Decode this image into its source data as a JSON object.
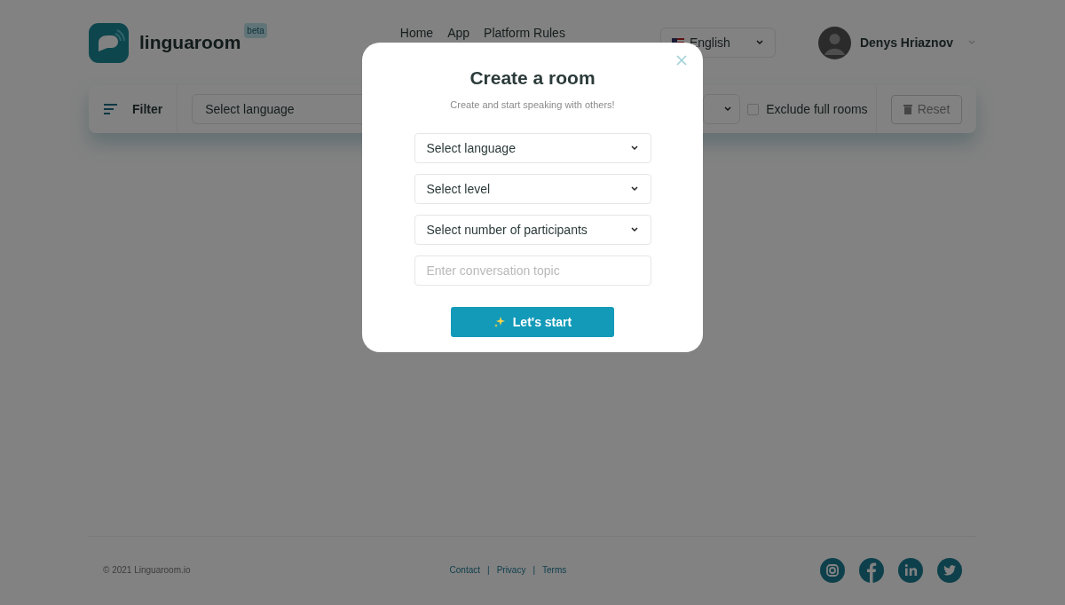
{
  "header": {
    "logo_text": "linguaroom",
    "badge": "beta",
    "nav": [
      "Home",
      "App",
      "Platform Rules"
    ],
    "language_select": {
      "value": "English"
    },
    "user": {
      "name": "Denys Hriaznov"
    }
  },
  "filter_bar": {
    "label": "Filter",
    "language_select": {
      "placeholder": "Select language"
    },
    "full_rooms_checkbox": {
      "label": "Exclude full rooms",
      "checked": false
    },
    "reset_button": {
      "label": "Reset"
    }
  },
  "modal": {
    "title": "Create a room",
    "subtitle": "Create and start speaking with others!",
    "selects": [
      {
        "placeholder": "Select language"
      },
      {
        "placeholder": "Select level"
      },
      {
        "placeholder": "Select number of participants"
      }
    ],
    "topic_input": {
      "placeholder": "Enter conversation topic"
    },
    "submit_button": {
      "label": "Let's start"
    }
  },
  "footer": {
    "copyright": "© 2021 Linguaroom.io",
    "links": [
      "Contact",
      "Privacy",
      "Terms"
    ],
    "separators": [
      "|",
      "|"
    ]
  }
}
